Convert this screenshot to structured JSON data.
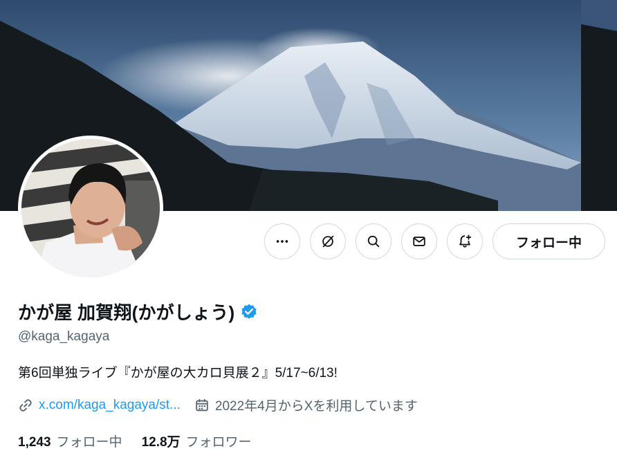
{
  "profile": {
    "display_name": "かが屋 加賀翔(かがしょう)",
    "handle": "@kaga_kagaya",
    "bio": "第6回単独ライブ『かが屋の大カロ貝展２』5/17~6/13!",
    "link_text": "x.com/kaga_kagaya/st...",
    "joined_text": "2022年4月からXを利用しています",
    "verified": true
  },
  "actions": {
    "more_icon": "more-horizontal-icon",
    "grok_icon": "grok-icon",
    "search_icon": "search-icon",
    "message_icon": "envelope-icon",
    "notify_icon": "bell-plus-icon",
    "follow_label": "フォロー中"
  },
  "stats": {
    "following_count": "1,243",
    "following_label": "フォロー中",
    "followers_count": "12.8万",
    "followers_label": "フォロワー"
  },
  "colors": {
    "accent": "#1d9bf0",
    "secondary_text": "#536471",
    "border": "#cfd9de"
  }
}
